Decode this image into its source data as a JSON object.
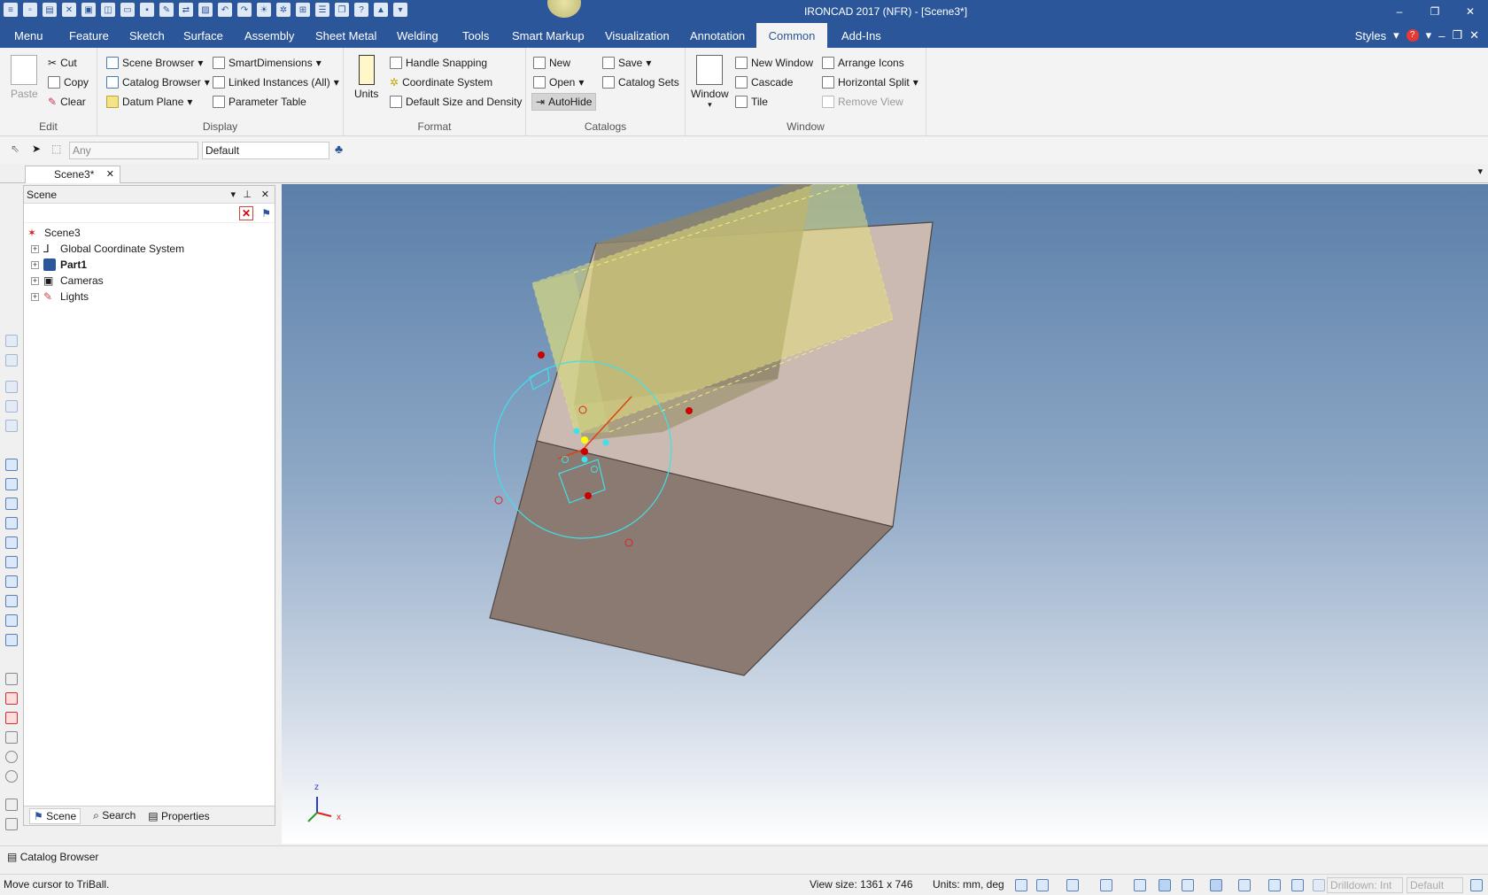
{
  "window": {
    "title": "IRONCAD 2017 (NFR) - [Scene3*]",
    "controls": [
      "–",
      "❐",
      "✕"
    ]
  },
  "menu": {
    "tabs": [
      "Menu",
      "Feature",
      "Sketch",
      "Surface",
      "Assembly",
      "Sheet Metal",
      "Welding",
      "Tools",
      "Smart Markup",
      "Visualization",
      "Annotation",
      "Common",
      "Add-Ins"
    ],
    "active_tab": "Common",
    "styles_label": "Styles",
    "help_glyph": "?"
  },
  "ribbon": {
    "edit": {
      "label": "Edit",
      "paste": "Paste",
      "cut": "Cut",
      "copy": "Copy",
      "clear": "Clear"
    },
    "display": {
      "label": "Display",
      "scene_browser": "Scene Browser",
      "catalog_browser": "Catalog Browser",
      "datum_plane": "Datum Plane",
      "smart_dimensions": "SmartDimensions",
      "linked_instances": "Linked Instances (All)",
      "parameter_table": "Parameter Table"
    },
    "format": {
      "label": "Format",
      "units": "Units",
      "handle_snapping": "Handle Snapping",
      "coordinate_system": "Coordinate System",
      "default_size": "Default Size and Density"
    },
    "catalogs": {
      "label": "Catalogs",
      "new": "New",
      "open": "Open",
      "autohide": "AutoHide",
      "save": "Save",
      "catalog_sets": "Catalog Sets"
    },
    "window_group": {
      "label": "Window",
      "window": "Window",
      "new_window": "New Window",
      "cascade": "Cascade",
      "tile": "Tile",
      "arrange_icons": "Arrange Icons",
      "horizontal_split": "Horizontal Split",
      "remove_view": "Remove View"
    }
  },
  "selection_bar": {
    "filter_value": "Any",
    "style_value": "Default"
  },
  "document_tab": {
    "label": "Scene3*",
    "close": "✕"
  },
  "scene_panel": {
    "title": "Scene",
    "tree": [
      {
        "label": "Scene3",
        "expander": "",
        "bold": false
      },
      {
        "label": "Global Coordinate System",
        "expander": "+",
        "bold": false
      },
      {
        "label": "Part1",
        "expander": "+",
        "bold": true
      },
      {
        "label": "Cameras",
        "expander": "+",
        "bold": false
      },
      {
        "label": "Lights",
        "expander": "+",
        "bold": false
      }
    ],
    "footer_tabs": [
      "Scene",
      "Search",
      "Properties"
    ]
  },
  "viewport": {
    "axis_labels": {
      "z": "z",
      "x": "x"
    }
  },
  "catalog_bar": {
    "label": "Catalog Browser"
  },
  "status": {
    "message": "Move cursor to TriBall.",
    "view_size": "View size: 1361 x  746",
    "units": "Units: mm, deg",
    "drilldown": "Drilldown: Int",
    "default": "Default"
  }
}
